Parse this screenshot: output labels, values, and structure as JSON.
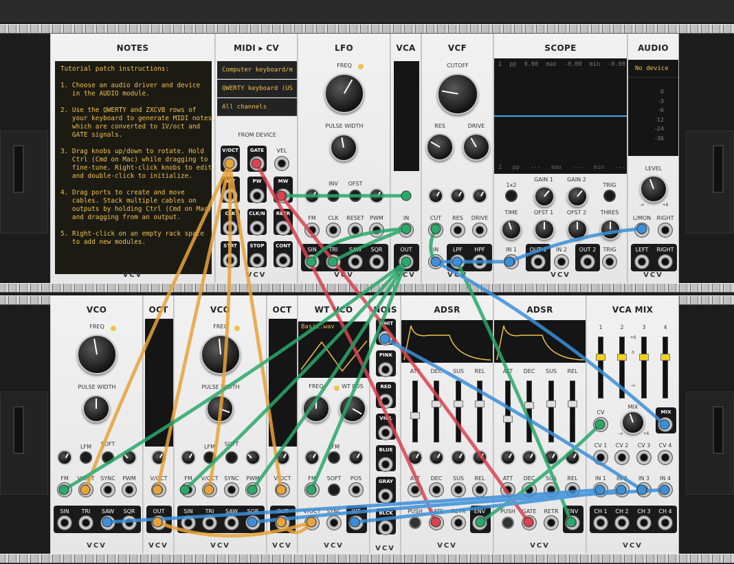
{
  "rack_modules": {
    "notes": {
      "title": "NOTES",
      "text": "Tutorial patch instructions:\n\n1. Choose an audio driver and device\n   in the AUDIO module.\n\n2. Use the QWERTY and ZXCVB rows of\n   your keyboard to generate MIDI notes,\n   which are converted to 1V/oct and\n   GATE signals.\n\n3. Drag knobs up/down to rotate. Hold\n   Ctrl (Cmd on Mac) while dragging to\n   fine-tune. Right-click knobs to edit,\n   and double-click to initialize.\n\n4. Drag ports to create and move\n   cables. Stack multiple cables on\n   outputs by holding Ctrl (Cmd on Mac)\n   and dragging from an output.\n\n5. Right-click on an empty rack space\n   to add new modules."
    },
    "midi_cv": {
      "title": "MIDI ▸ CV",
      "driver": "Computer keyboard/m",
      "device": "QWERTY keyboard (US",
      "channel": "All channels",
      "section": "FROM DEVICE",
      "ports": [
        "V/OCT",
        "GATE",
        "VEL",
        "AFT",
        "PW",
        "MW",
        "CLK",
        "CLK/N",
        "RETR",
        "STRT",
        "STOP",
        "CONT"
      ]
    },
    "lfo": {
      "title": "LFO",
      "freq": "FREQ",
      "pulse_width": "PULSE WIDTH",
      "small": [
        "INV",
        "OFST"
      ],
      "inputs": [
        "FM",
        "CLK",
        "RESET",
        "PWM"
      ],
      "outputs": [
        "SIN",
        "TRI",
        "SAW",
        "SQR"
      ]
    },
    "vca": {
      "title": "VCA",
      "in": "IN",
      "out": "OUT"
    },
    "vcf": {
      "title": "VCF",
      "cutoff": "CUTOFF",
      "res": "RES",
      "drive": "DRIVE",
      "inputs": [
        "CUT",
        "RES",
        "DRIVE"
      ],
      "in": "IN",
      "outputs": [
        "LPF",
        "HPF"
      ]
    },
    "scope": {
      "title": "SCOPE",
      "top": [
        "1",
        "pp",
        "0.00",
        "max",
        "-0.00",
        "min",
        "-0.00"
      ],
      "bottom": [
        "2",
        "pp",
        "---",
        "max",
        "---",
        "min",
        "---"
      ],
      "knobs": [
        "1x2",
        "GAIN 1",
        "GAIN 2",
        "TRIG",
        "TIME",
        "OFST 1",
        "OFST 2",
        "THRES"
      ],
      "ports": [
        "IN 1",
        "OUT 1",
        "IN 2",
        "OUT 2",
        "TRIG"
      ]
    },
    "audio": {
      "title": "AUDIO",
      "device": "No device",
      "meter": [
        "0",
        "-3",
        "-6",
        "-12",
        "-24",
        "-36"
      ],
      "level": "LEVEL",
      "level_min": "-∞",
      "level_max": "+6",
      "ports": [
        "L/MON",
        "RIGHT",
        "LEFT",
        "RIGHT"
      ]
    },
    "vco1": {
      "title": "VCO",
      "freq": "FREQ",
      "pulse_width": "PULSE WIDTH",
      "small": [
        "LFM",
        "SOFT"
      ],
      "inputs": [
        "FM",
        "V/OCT",
        "SYNC",
        "PWM"
      ],
      "outputs": [
        "SIN",
        "TRI",
        "SAW",
        "SQR"
      ]
    },
    "oct1": {
      "title": "OCT",
      "v": "V/OCT",
      "out": "OUT"
    },
    "vco2": {
      "title": "VCO",
      "freq": "FREQ",
      "pulse_width": "PULSE WIDTH",
      "small": [
        "LFM",
        "SOFT"
      ],
      "inputs": [
        "FM",
        "V/OCT",
        "SYNC",
        "PWM"
      ],
      "outputs": [
        "SIN",
        "TRI",
        "SAW",
        "SQR"
      ]
    },
    "oct2": {
      "title": "OCT",
      "v": "V/OCT",
      "out": "OUT"
    },
    "wtvco": {
      "title": "WT VCO",
      "file": "Basic.wav",
      "freq": "FREQ",
      "wtpos": "WT POS",
      "small": [
        "LFM"
      ],
      "ports1": [
        "FM",
        "SOFT",
        "POS"
      ],
      "ports2": [
        "V/OCT",
        "SYNC",
        "WT"
      ]
    },
    "noise": {
      "title": "NOIS",
      "items": [
        "WHIT",
        "PINK",
        "RED",
        "VIOL",
        "BLUE",
        "GRAY",
        "BLCK"
      ]
    },
    "adsr1": {
      "title": "ADSR",
      "sliders": [
        "ATT",
        "DEC",
        "SUS",
        "REL"
      ],
      "ports": [
        "PUSH",
        "GATE",
        "RETR",
        "ENV"
      ]
    },
    "adsr2": {
      "title": "ADSR",
      "sliders": [
        "ATT",
        "DEC",
        "SUS",
        "REL"
      ],
      "ports": [
        "PUSH",
        "GATE",
        "RETR",
        "ENV"
      ]
    },
    "vcamix": {
      "title": "VCA MIX",
      "channels": [
        "1",
        "2",
        "3",
        "4"
      ],
      "scale": [
        "+6",
        "0",
        "-∞"
      ],
      "cv": "CV",
      "mix": "MIX",
      "mix_min": "-∞",
      "mix_max": "+6",
      "mixbtn": "MIX",
      "cvs": [
        "CV 1",
        "CV 2",
        "CV 3",
        "CV 4"
      ],
      "ins": [
        "IN 1",
        "IN 2",
        "IN 3",
        "IN 4"
      ],
      "chs": [
        "CH 1",
        "CH 2",
        "CH 3",
        "CH 4"
      ]
    },
    "brand": "VCV"
  },
  "colors": {
    "orange": "#e8a33a",
    "red": "#d9434f",
    "green": "#2aa86a",
    "blue": "#3b8fd9",
    "led_yellow": "#f2d21b",
    "amber": "#f2c14d"
  }
}
